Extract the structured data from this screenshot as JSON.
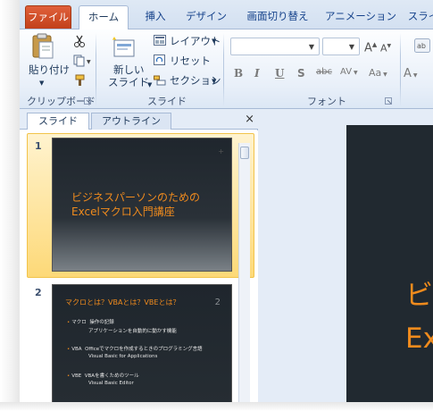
{
  "tabs": [
    "ファイル",
    "ホーム",
    "挿入",
    "デザイン",
    "画面切り替え",
    "アニメーション",
    "スライ"
  ],
  "ribbon": {
    "clipboard": {
      "paste": "貼り付け",
      "label": "クリップボード"
    },
    "slides": {
      "new_slide_1": "新しい",
      "new_slide_2": "スライド",
      "layout": "レイアウト",
      "reset": "リセット",
      "section": "セクション",
      "label": "スライド"
    },
    "font": {
      "label": "フォント",
      "bold": "B",
      "italic": "I",
      "underline": "U",
      "shadow": "S",
      "strike": "abc",
      "spacing": "AV",
      "case": "Aa",
      "grow": "A",
      "shrink": "A"
    }
  },
  "pane": {
    "tab_slides": "スライド",
    "tab_outline": "アウトライン",
    "close": "×"
  },
  "slides": [
    {
      "number": "1",
      "title_line1": "ビジネスパーソンのための",
      "title_line2": "Excelマクロ入門講座"
    },
    {
      "number": "2",
      "heading": "マクロとは？VBAとは？VBEとは？",
      "page_num": "2",
      "bullets": [
        {
          "term": "マクロ",
          "desc": "操作の記録",
          "sub": "アプリケーションを自動的に動かす機能"
        },
        {
          "term": "VBA",
          "desc": "Officeでマクロを作成するときのプログラミング言語",
          "sub": "Visual Basic for Applications"
        },
        {
          "term": "VBE",
          "desc": "VBAを書くためのツール",
          "sub": "Visual Basic Editor"
        }
      ]
    }
  ],
  "main": {
    "big_line1": "ビ",
    "big_line2": "Ex"
  },
  "colors": {
    "accent": "#f08b1d",
    "file_tab": "#c2401a",
    "selection": "#fdd978"
  }
}
